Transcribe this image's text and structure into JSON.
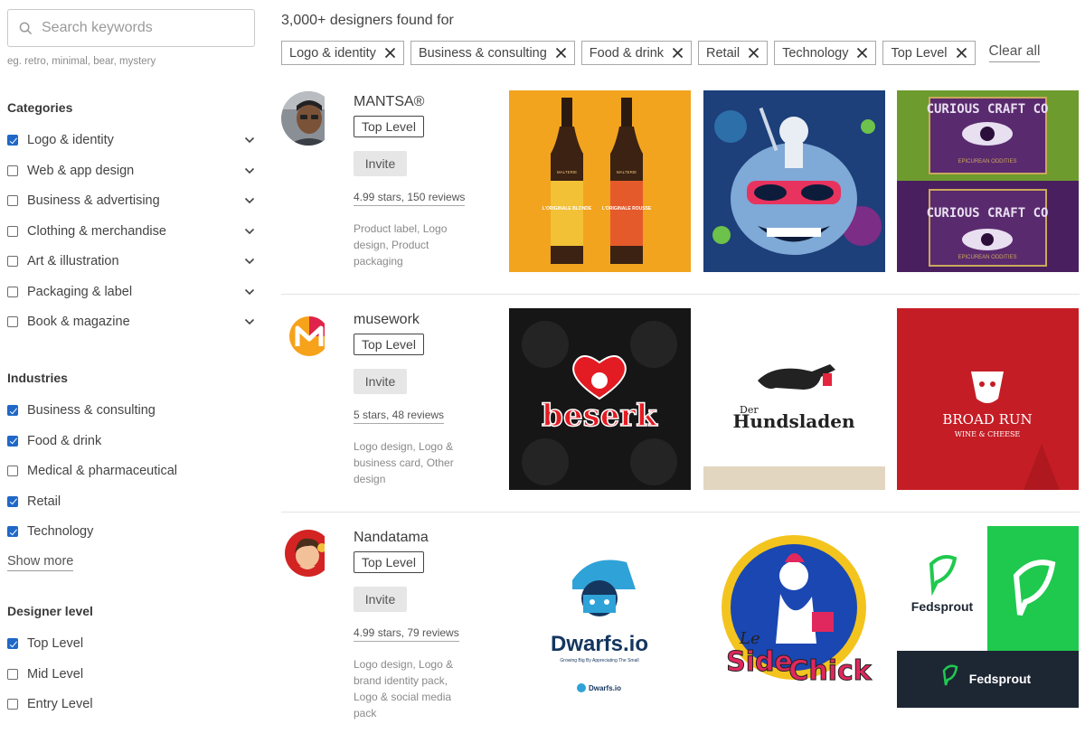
{
  "search": {
    "placeholder": "Search keywords",
    "hint": "eg. retro, minimal, bear, mystery"
  },
  "categories": {
    "title": "Categories",
    "items": [
      {
        "label": "Logo & identity",
        "checked": true
      },
      {
        "label": "Web & app design",
        "checked": false
      },
      {
        "label": "Business & advertising",
        "checked": false
      },
      {
        "label": "Clothing & merchandise",
        "checked": false
      },
      {
        "label": "Art & illustration",
        "checked": false
      },
      {
        "label": "Packaging & label",
        "checked": false
      },
      {
        "label": "Book & magazine",
        "checked": false
      }
    ]
  },
  "industries": {
    "title": "Industries",
    "items": [
      {
        "label": "Business & consulting",
        "checked": true
      },
      {
        "label": "Food & drink",
        "checked": true
      },
      {
        "label": "Medical & pharmaceutical",
        "checked": false
      },
      {
        "label": "Retail",
        "checked": true
      },
      {
        "label": "Technology",
        "checked": true
      }
    ],
    "show_more": "Show more"
  },
  "designer_level": {
    "title": "Designer level",
    "items": [
      {
        "label": "Top Level",
        "checked": true
      },
      {
        "label": "Mid Level",
        "checked": false
      },
      {
        "label": "Entry Level",
        "checked": false
      }
    ]
  },
  "results": {
    "title": "3,000+ designers found for",
    "filters": [
      "Logo & identity",
      "Business & consulting",
      "Food & drink",
      "Retail",
      "Technology",
      "Top Level"
    ],
    "clear_all": "Clear all"
  },
  "designers": [
    {
      "name": "MANTSA®",
      "level": "Top Level",
      "invite": "Invite",
      "rating": "4.99 stars, 150 reviews",
      "specialties": "Product label, Logo design, Product packaging",
      "portfolio": {
        "beer_brand": "MALTERIE",
        "beer_left": "L'ORIGINALE BLONDE",
        "beer_right": "L'ORIGINALE ROUSSE",
        "craft": "CURIOUS CRAFT CO",
        "craft_sub": "EPICUREAN ODDITIES"
      }
    },
    {
      "name": "musework",
      "level": "Top Level",
      "invite": "Invite",
      "rating": "5 stars, 48 reviews",
      "specialties": "Logo design, Logo & business card, Other design",
      "portfolio": {
        "beserk": "beserk",
        "der": "Der",
        "hundsladen": "Hundsladen",
        "broad_run": "BROAD RUN",
        "wine_cheese": "WINE & CHEESE"
      }
    },
    {
      "name": "Nandatama",
      "level": "Top Level",
      "invite": "Invite",
      "rating": "4.99 stars, 79 reviews",
      "specialties": "Logo design, Logo & brand identity pack, Logo & social media pack",
      "portfolio": {
        "dwarfs": "Dwarfs.io",
        "dwarfs_tag": "Growing Big By Appreciating The Small",
        "dwarfs_small": "Dwarfs.io",
        "le": "Le",
        "side": "Side",
        "chick": "Chick",
        "fedsprout": "Fedsprout",
        "fedsprout_dark": "Fedsprout"
      }
    }
  ],
  "colors": {
    "accent": "#1f68c7",
    "chip_border": "#a8a8a8",
    "invite_bg": "#e6e6e6"
  },
  "icons": {
    "search": "search-icon",
    "remove": "close-icon",
    "expand": "chevron-down-icon"
  }
}
